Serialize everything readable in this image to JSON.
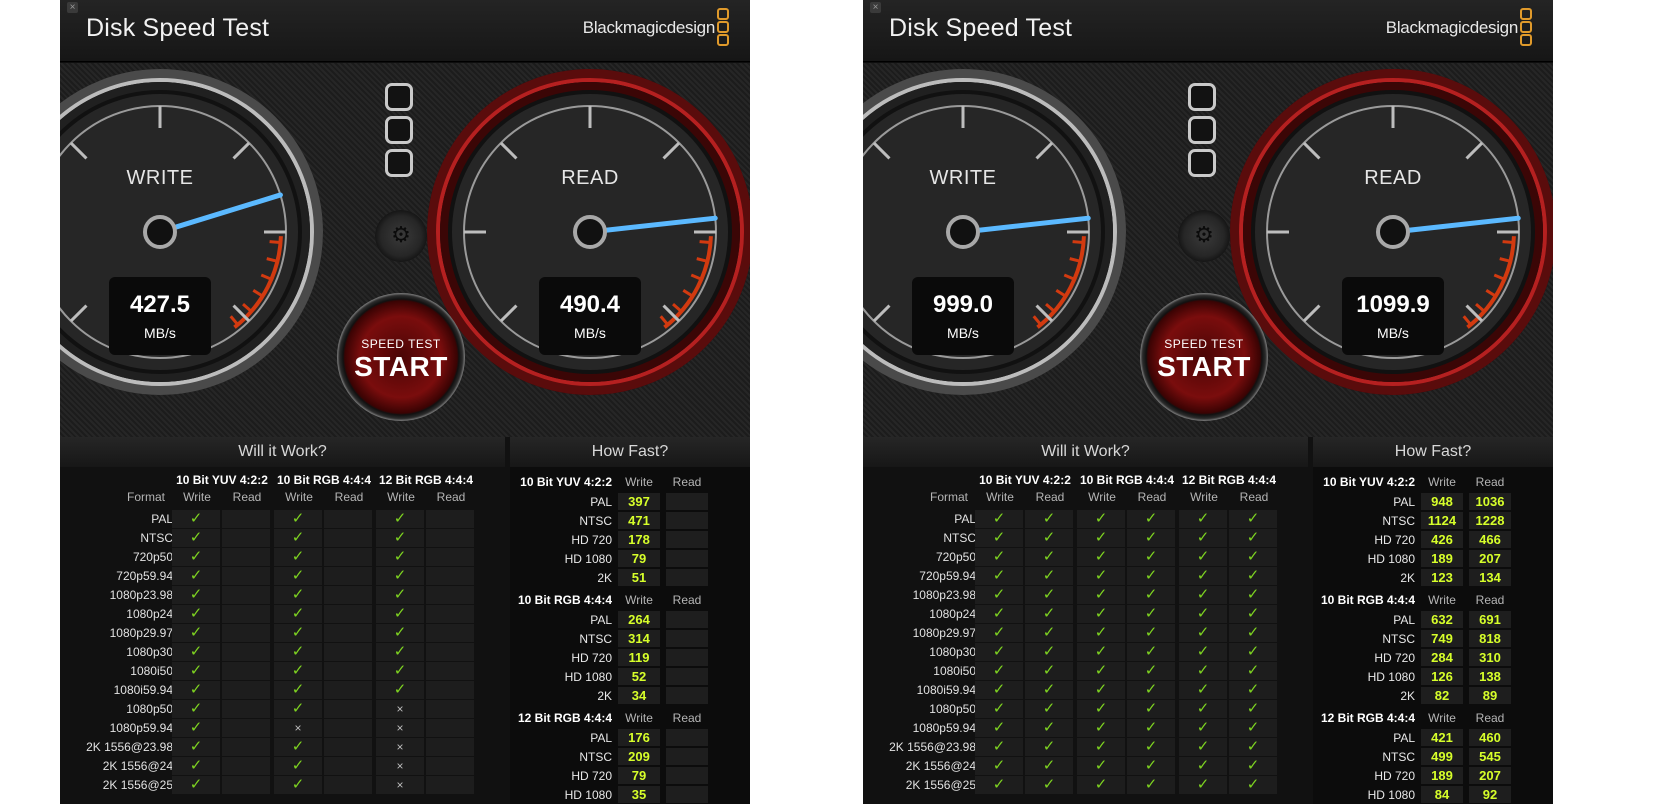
{
  "app": {
    "title": "Disk Speed Test",
    "brand": "Blackmagicdesign",
    "close": "×"
  },
  "colors": {
    "check": "#7ed321",
    "value": "#d7ff2a",
    "needle": "#5bb9ff",
    "brand_orange": "#e09a2b"
  },
  "icons": {
    "check": "checkmark-icon",
    "cross": "cross-icon",
    "gear": "gear-icon",
    "close": "close-icon"
  },
  "start_button": {
    "line1": "SPEED TEST",
    "line2": "START"
  },
  "sections": {
    "will": "Will it Work?",
    "how": "How Fast?"
  },
  "will_headers": {
    "format": "Format",
    "groups": [
      "10 Bit YUV 4:2:2",
      "10 Bit RGB 4:4:4",
      "12 Bit RGB 4:4:4"
    ],
    "write": "Write",
    "read": "Read"
  },
  "how_headers": {
    "write": "Write",
    "read": "Read"
  },
  "formats": [
    "PAL",
    "NTSC",
    "720p50",
    "720p59.94",
    "1080p23.98",
    "1080p24",
    "1080p29.97",
    "1080p30",
    "1080i50",
    "1080i59.94",
    "1080p50",
    "1080p59.94",
    "2K 1556@23.98",
    "2K 1556@24",
    "2K 1556@25"
  ],
  "tests": [
    {
      "write": {
        "label": "WRITE",
        "value": "427.5",
        "unit": "MB/s",
        "needle_fraction": 0.77
      },
      "read": {
        "label": "READ",
        "value": "490.4",
        "unit": "MB/s",
        "needle_fraction": 0.81
      },
      "will": [
        [
          "✓",
          "",
          "✓",
          "",
          "✓",
          ""
        ],
        [
          "✓",
          "",
          "✓",
          "",
          "✓",
          ""
        ],
        [
          "✓",
          "",
          "✓",
          "",
          "✓",
          ""
        ],
        [
          "✓",
          "",
          "✓",
          "",
          "✓",
          ""
        ],
        [
          "✓",
          "",
          "✓",
          "",
          "✓",
          ""
        ],
        [
          "✓",
          "",
          "✓",
          "",
          "✓",
          ""
        ],
        [
          "✓",
          "",
          "✓",
          "",
          "✓",
          ""
        ],
        [
          "✓",
          "",
          "✓",
          "",
          "✓",
          ""
        ],
        [
          "✓",
          "",
          "✓",
          "",
          "✓",
          ""
        ],
        [
          "✓",
          "",
          "✓",
          "",
          "✓",
          ""
        ],
        [
          "✓",
          "",
          "✓",
          "",
          "×",
          ""
        ],
        [
          "✓",
          "",
          "×",
          "",
          "×",
          ""
        ],
        [
          "✓",
          "",
          "✓",
          "",
          "×",
          ""
        ],
        [
          "✓",
          "",
          "✓",
          "",
          "×",
          ""
        ],
        [
          "✓",
          "",
          "✓",
          "",
          "×",
          ""
        ]
      ],
      "how": [
        {
          "group": "10 Bit YUV 4:2:2",
          "rows": [
            [
              "PAL",
              "397",
              ""
            ],
            [
              "NTSC",
              "471",
              ""
            ],
            [
              "HD 720",
              "178",
              ""
            ],
            [
              "HD 1080",
              "79",
              ""
            ],
            [
              "2K",
              "51",
              ""
            ]
          ]
        },
        {
          "group": "10 Bit RGB 4:4:4",
          "rows": [
            [
              "PAL",
              "264",
              ""
            ],
            [
              "NTSC",
              "314",
              ""
            ],
            [
              "HD 720",
              "119",
              ""
            ],
            [
              "HD 1080",
              "52",
              ""
            ],
            [
              "2K",
              "34",
              ""
            ]
          ]
        },
        {
          "group": "12 Bit RGB 4:4:4",
          "rows": [
            [
              "PAL",
              "176",
              ""
            ],
            [
              "NTSC",
              "209",
              ""
            ],
            [
              "HD 720",
              "79",
              ""
            ],
            [
              "HD 1080",
              "35",
              ""
            ]
          ]
        }
      ]
    },
    {
      "write": {
        "label": "WRITE",
        "value": "999.0",
        "unit": "MB/s",
        "needle_fraction": 0.81
      },
      "read": {
        "label": "READ",
        "value": "1099.9",
        "unit": "MB/s",
        "needle_fraction": 0.81
      },
      "will": [
        [
          "✓",
          "✓",
          "✓",
          "✓",
          "✓",
          "✓"
        ],
        [
          "✓",
          "✓",
          "✓",
          "✓",
          "✓",
          "✓"
        ],
        [
          "✓",
          "✓",
          "✓",
          "✓",
          "✓",
          "✓"
        ],
        [
          "✓",
          "✓",
          "✓",
          "✓",
          "✓",
          "✓"
        ],
        [
          "✓",
          "✓",
          "✓",
          "✓",
          "✓",
          "✓"
        ],
        [
          "✓",
          "✓",
          "✓",
          "✓",
          "✓",
          "✓"
        ],
        [
          "✓",
          "✓",
          "✓",
          "✓",
          "✓",
          "✓"
        ],
        [
          "✓",
          "✓",
          "✓",
          "✓",
          "✓",
          "✓"
        ],
        [
          "✓",
          "✓",
          "✓",
          "✓",
          "✓",
          "✓"
        ],
        [
          "✓",
          "✓",
          "✓",
          "✓",
          "✓",
          "✓"
        ],
        [
          "✓",
          "✓",
          "✓",
          "✓",
          "✓",
          "✓"
        ],
        [
          "✓",
          "✓",
          "✓",
          "✓",
          "✓",
          "✓"
        ],
        [
          "✓",
          "✓",
          "✓",
          "✓",
          "✓",
          "✓"
        ],
        [
          "✓",
          "✓",
          "✓",
          "✓",
          "✓",
          "✓"
        ],
        [
          "✓",
          "✓",
          "✓",
          "✓",
          "✓",
          "✓"
        ]
      ],
      "how": [
        {
          "group": "10 Bit YUV 4:2:2",
          "rows": [
            [
              "PAL",
              "948",
              "1036"
            ],
            [
              "NTSC",
              "1124",
              "1228"
            ],
            [
              "HD 720",
              "426",
              "466"
            ],
            [
              "HD 1080",
              "189",
              "207"
            ],
            [
              "2K",
              "123",
              "134"
            ]
          ]
        },
        {
          "group": "10 Bit RGB 4:4:4",
          "rows": [
            [
              "PAL",
              "632",
              "691"
            ],
            [
              "NTSC",
              "749",
              "818"
            ],
            [
              "HD 720",
              "284",
              "310"
            ],
            [
              "HD 1080",
              "126",
              "138"
            ],
            [
              "2K",
              "82",
              "89"
            ]
          ]
        },
        {
          "group": "12 Bit RGB 4:4:4",
          "rows": [
            [
              "PAL",
              "421",
              "460"
            ],
            [
              "NTSC",
              "499",
              "545"
            ],
            [
              "HD 720",
              "189",
              "207"
            ],
            [
              "HD 1080",
              "84",
              "92"
            ]
          ]
        }
      ]
    }
  ]
}
